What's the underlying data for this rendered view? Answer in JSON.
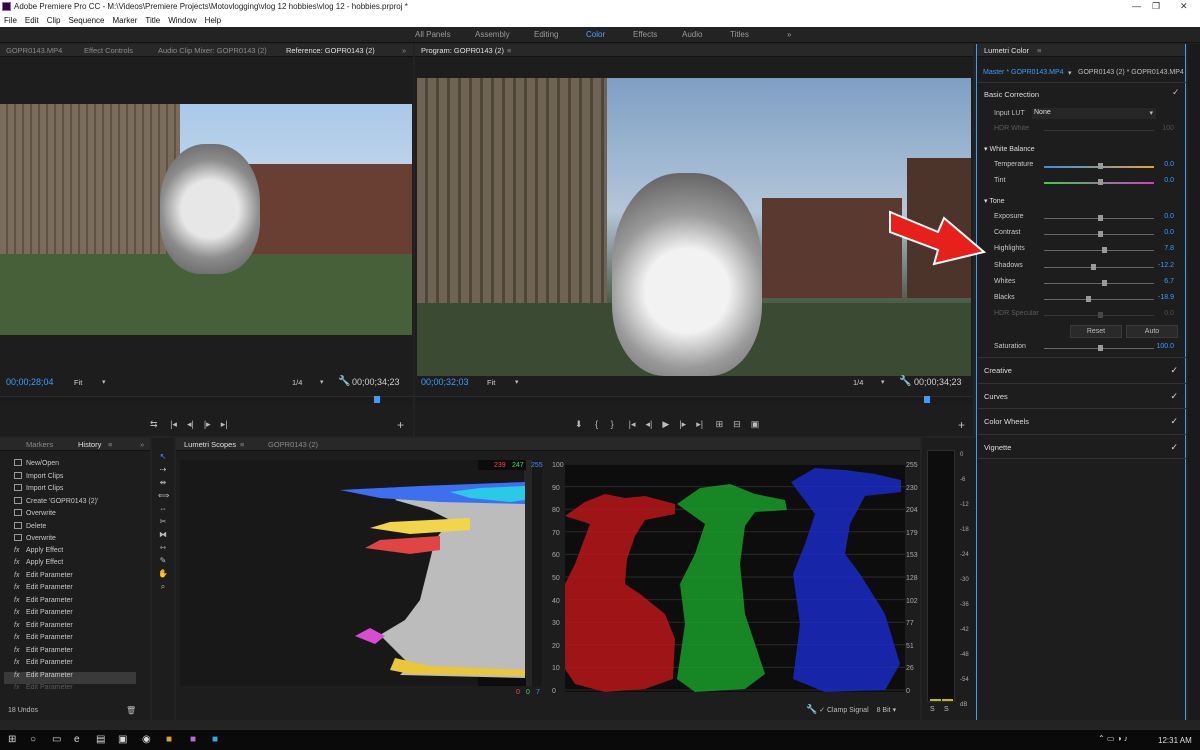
{
  "window": {
    "title": "Adobe Premiere Pro CC - M:\\Videos\\Premiere Projects\\Motovlogging\\vlog 12 hobbies\\vlog 12 - hobbies.prproj *",
    "min_glyph": "—",
    "max_glyph": "❐",
    "close_glyph": "✕"
  },
  "menu": [
    "File",
    "Edit",
    "Clip",
    "Sequence",
    "Marker",
    "Title",
    "Window",
    "Help"
  ],
  "workspaces": [
    "All Panels",
    "Assembly",
    "Editing",
    "Color",
    "Effects",
    "Audio",
    "Titles",
    "»"
  ],
  "source_tabs": {
    "t1": "GOPR0143.MP4",
    "t2": "Effect Controls",
    "t3": "Audio Clip Mixer: GOPR0143 (2)",
    "t4": "Reference: GOPR0143 (2)",
    "more": "»"
  },
  "reference": {
    "timecode": "00;00;28;04",
    "fit": "Fit",
    "ratio": "1/4",
    "duration": "00;00;34;23"
  },
  "program": {
    "tab": "Program: GOPR0143 (2)",
    "timecode": "00;00;32;03",
    "fit": "Fit",
    "ratio": "1/4",
    "duration": "00;00;34;23"
  },
  "history": {
    "tab_markers": "Markers",
    "tab_history": "History",
    "more": "»",
    "footer": "18 Undos",
    "items": [
      "New/Open",
      "Import Clips",
      "Import Clips",
      "Create 'GOPR0143 (2)'",
      "Overwrite",
      "Delete",
      "Overwrite",
      "Apply Effect",
      "Apply Effect",
      "Edit Parameter",
      "Edit Parameter",
      "Edit Parameter",
      "Edit Parameter",
      "Edit Parameter",
      "Edit Parameter",
      "Edit Parameter",
      "Edit Parameter",
      "Edit Parameter",
      "Edit Parameter"
    ]
  },
  "scopes": {
    "tab": "Lumetri Scopes",
    "tab2": "GOPR0143 (2)",
    "rgb_top": [
      "239",
      "247",
      "255"
    ],
    "rgb_bottom": [
      "0",
      "0",
      "7"
    ],
    "left_scale": [
      "100",
      "90",
      "80",
      "70",
      "60",
      "50",
      "40",
      "30",
      "20",
      "10",
      "0"
    ],
    "right_scale": [
      "255",
      "230",
      "204",
      "179",
      "153",
      "128",
      "102",
      "77",
      "51",
      "26",
      "0"
    ],
    "clamp": "Clamp Signal",
    "bits": "8 Bit"
  },
  "meter": {
    "scale": [
      "0",
      "-6",
      "-12",
      "-18",
      "-24",
      "-30",
      "-36",
      "-42",
      "-48",
      "-54",
      "dB"
    ],
    "solo": [
      "S",
      "S"
    ]
  },
  "lumetri": {
    "title": "Lumetri Color",
    "master": "Master * GOPR0143.MP4",
    "clip": "GOPR0143 (2) * GOPR0143.MP4",
    "basic": "Basic Correction",
    "input_lut": "Input LUT",
    "lut_value": "None",
    "hdr_white": "HDR White",
    "hdr_white_val": "100",
    "wb": "White Balance",
    "temperature": "Temperature",
    "temperature_val": "0.0",
    "tint": "Tint",
    "tint_val": "0.0",
    "tone": "Tone",
    "tone_rows": [
      {
        "label": "Exposure",
        "value": "0.0"
      },
      {
        "label": "Contrast",
        "value": "0.0"
      },
      {
        "label": "Highlights",
        "value": "7.8"
      },
      {
        "label": "Shadows",
        "value": "-12.2"
      },
      {
        "label": "Whites",
        "value": "6.7"
      },
      {
        "label": "Blacks",
        "value": "-18.9"
      },
      {
        "label": "HDR Specular",
        "value": "0.0"
      }
    ],
    "reset": "Reset",
    "auto": "Auto",
    "saturation": "Saturation",
    "saturation_val": "100.0",
    "sections": [
      "Creative",
      "Curves",
      "Color Wheels",
      "Vignette"
    ]
  },
  "taskbar": {
    "time": "12:31 AM"
  },
  "colors": {
    "accent": "#3d9cff",
    "arrow": "#e8201c"
  }
}
